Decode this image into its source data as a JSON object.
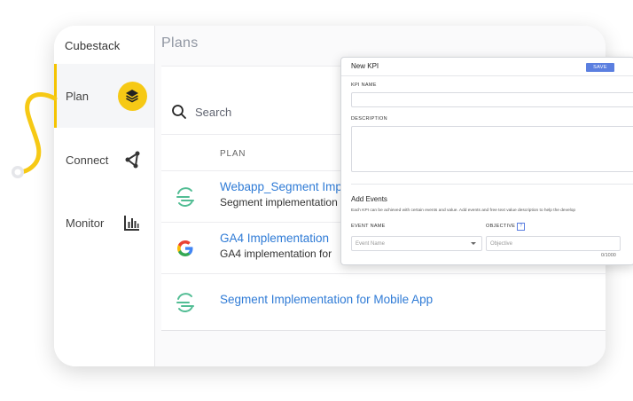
{
  "sidebar": {
    "brand": "Cubestack",
    "items": [
      {
        "label": "Plan",
        "icon": "layers-icon",
        "active": true
      },
      {
        "label": "Connect",
        "icon": "connect-icon",
        "active": false
      },
      {
        "label": "Monitor",
        "icon": "bar-chart-icon",
        "active": false
      }
    ]
  },
  "main": {
    "title": "Plans",
    "search": {
      "placeholder": "Search"
    },
    "column_header": "PLAN",
    "rows": [
      {
        "name": "Webapp_Segment Imp",
        "description": "Segment implementation",
        "logo": "segment-logo-icon"
      },
      {
        "name": "GA4 Implementation",
        "description": "GA4 implementation for",
        "logo": "google-logo-icon"
      },
      {
        "name": "Segment Implementation for Mobile App",
        "description": "",
        "logo": "segment-logo-icon"
      }
    ]
  },
  "modal": {
    "title": "New KPI",
    "save_label": "SAVE",
    "kpi_name_label": "KPI NAME",
    "description_label": "DESCRIPTION",
    "add_events_title": "Add Events",
    "help_text": "Each KPI can be achieved with certain events and value. Add events and free text value description to help the develop",
    "event_name_label": "EVENT NAME",
    "event_name_placeholder": "Event Name",
    "objective_label": "OBJECTIVE",
    "objective_help": "?",
    "objective_placeholder": "Objective",
    "counter": "0/1000"
  },
  "colors": {
    "accent_yellow": "#f6c915",
    "link_blue": "#2f7bd6",
    "save_button": "#5b7fe0",
    "segment_green": "#52bd94"
  }
}
